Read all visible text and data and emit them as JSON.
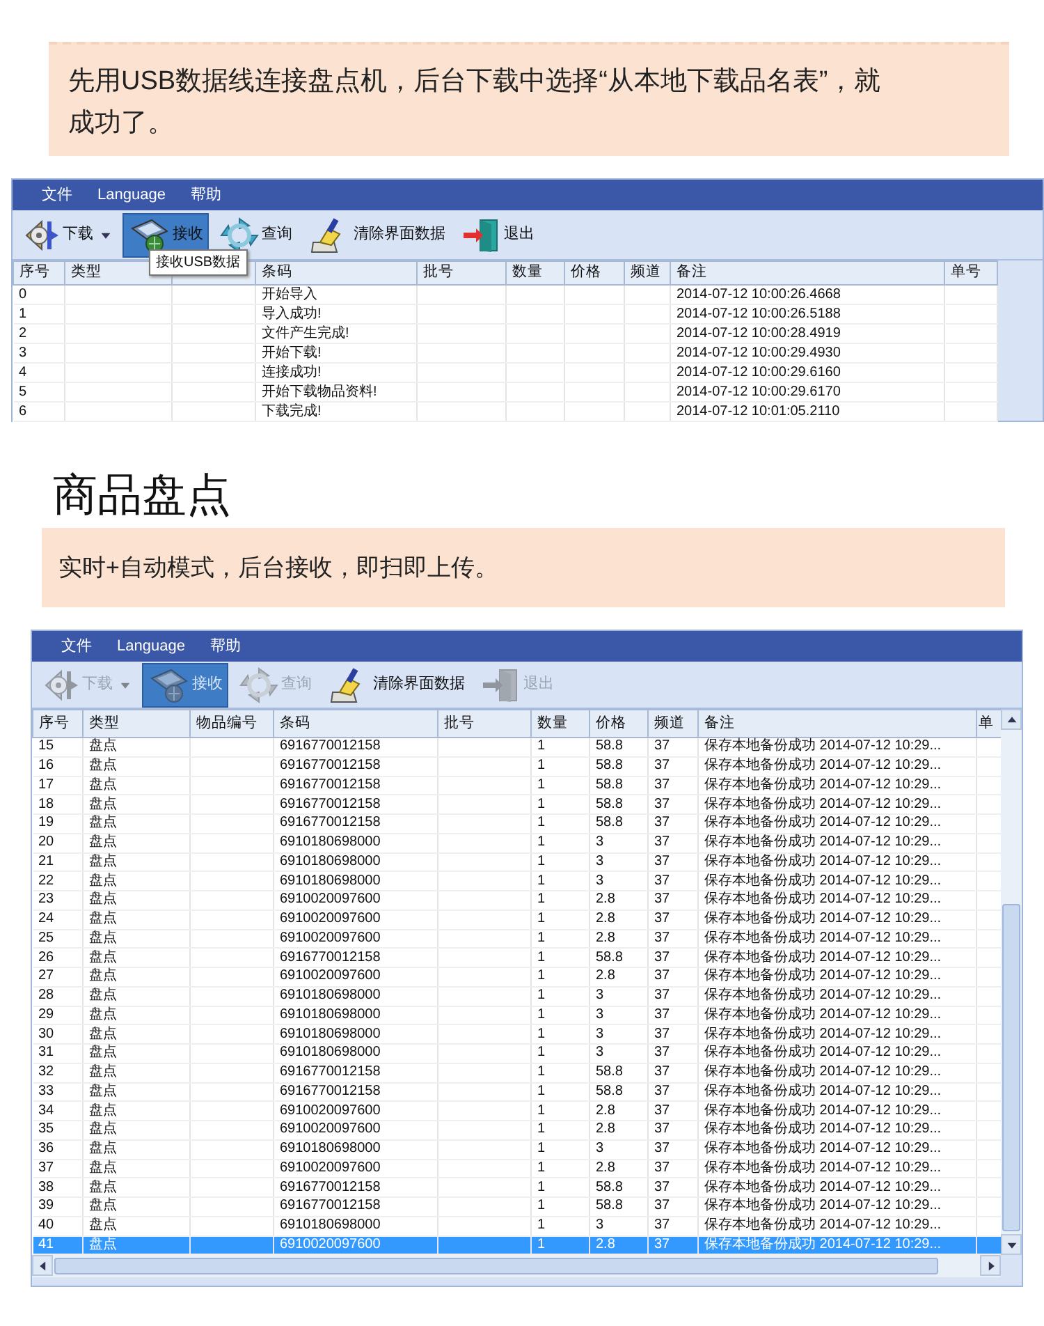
{
  "note_top": {
    "text": "先用USB数据线连接盘点机，后台下载中选择“从本地下载品名表”，就成功了。"
  },
  "windows": [
    {
      "menu": [
        "文件",
        "Language",
        "帮助"
      ],
      "toolbar": [
        {
          "kind": "download",
          "label": "下载",
          "dropdown": true,
          "disabled": false,
          "selected": false
        },
        {
          "kind": "receive",
          "label": "接收",
          "dropdown": false,
          "disabled": false,
          "selected": true
        },
        {
          "kind": "query",
          "label": "查询",
          "dropdown": false,
          "disabled": false,
          "selected": false
        },
        {
          "kind": "clear",
          "label": "清除界面数据",
          "dropdown": false,
          "disabled": false,
          "selected": false
        },
        {
          "kind": "exit",
          "label": "退出",
          "dropdown": false,
          "disabled": false,
          "selected": false
        }
      ],
      "tooltip": "接收USB数据",
      "scrollbars": false,
      "columns": [
        "序号",
        "类型",
        null,
        "条码",
        "批号",
        "数量",
        "价格",
        "频道",
        "备注",
        "单号"
      ],
      "rows": [
        {
          "cells": [
            "0",
            null,
            null,
            "开始导入",
            null,
            null,
            null,
            null,
            "2014-07-12 10:00:26.4668",
            null
          ]
        },
        {
          "cells": [
            "1",
            null,
            null,
            "导入成功!",
            null,
            null,
            null,
            null,
            "2014-07-12 10:00:26.5188",
            null
          ]
        },
        {
          "cells": [
            "2",
            null,
            null,
            "文件产生完成!",
            null,
            null,
            null,
            null,
            "2014-07-12 10:00:28.4919",
            null
          ]
        },
        {
          "cells": [
            "3",
            null,
            null,
            "开始下载!",
            null,
            null,
            null,
            null,
            "2014-07-12 10:00:29.4930",
            null
          ]
        },
        {
          "cells": [
            "4",
            null,
            null,
            "连接成功!",
            null,
            null,
            null,
            null,
            "2014-07-12 10:00:29.6160",
            null
          ]
        },
        {
          "cells": [
            "5",
            null,
            null,
            "开始下载物品资料!",
            null,
            null,
            null,
            null,
            "2014-07-12 10:00:29.6170",
            null
          ]
        },
        {
          "cells": [
            "6",
            null,
            null,
            "下载完成!",
            null,
            null,
            null,
            null,
            "2014-07-12 10:01:05.2110",
            null
          ]
        }
      ]
    },
    {
      "heading": "商品盘点",
      "note": "实时+自动模式，后台接收，即扫即上传。",
      "menu": [
        "文件",
        "Language",
        "帮助"
      ],
      "toolbar": [
        {
          "kind": "download",
          "label": "下载",
          "dropdown": true,
          "disabled": true,
          "selected": false
        },
        {
          "kind": "receive",
          "label": "接收",
          "dropdown": false,
          "disabled": true,
          "selected": true
        },
        {
          "kind": "query",
          "label": "查询",
          "dropdown": false,
          "disabled": true,
          "selected": false
        },
        {
          "kind": "clear",
          "label": "清除界面数据",
          "dropdown": false,
          "disabled": false,
          "selected": false
        },
        {
          "kind": "exit",
          "label": "退出",
          "dropdown": false,
          "disabled": true,
          "selected": false
        }
      ],
      "scrollbars": true,
      "columns": [
        "序号",
        "类型",
        "物品编号",
        "条码",
        "批号",
        "数量",
        "价格",
        "频道",
        "备注",
        "单"
      ],
      "rows": [
        {
          "selected": false,
          "cells": [
            "15",
            "盘点",
            null,
            "6916770012158",
            null,
            "1",
            "58.8",
            "37",
            "保存本地备份成功 2014-07-12 10:29...",
            null
          ]
        },
        {
          "selected": false,
          "cells": [
            "16",
            "盘点",
            null,
            "6916770012158",
            null,
            "1",
            "58.8",
            "37",
            "保存本地备份成功 2014-07-12 10:29...",
            null
          ]
        },
        {
          "selected": false,
          "cells": [
            "17",
            "盘点",
            null,
            "6916770012158",
            null,
            "1",
            "58.8",
            "37",
            "保存本地备份成功 2014-07-12 10:29...",
            null
          ]
        },
        {
          "selected": false,
          "cells": [
            "18",
            "盘点",
            null,
            "6916770012158",
            null,
            "1",
            "58.8",
            "37",
            "保存本地备份成功 2014-07-12 10:29...",
            null
          ]
        },
        {
          "selected": false,
          "cells": [
            "19",
            "盘点",
            null,
            "6916770012158",
            null,
            "1",
            "58.8",
            "37",
            "保存本地备份成功 2014-07-12 10:29...",
            null
          ]
        },
        {
          "selected": false,
          "cells": [
            "20",
            "盘点",
            null,
            "6910180698000",
            null,
            "1",
            "3",
            "37",
            "保存本地备份成功 2014-07-12 10:29...",
            null
          ]
        },
        {
          "selected": false,
          "cells": [
            "21",
            "盘点",
            null,
            "6910180698000",
            null,
            "1",
            "3",
            "37",
            "保存本地备份成功 2014-07-12 10:29...",
            null
          ]
        },
        {
          "selected": false,
          "cells": [
            "22",
            "盘点",
            null,
            "6910180698000",
            null,
            "1",
            "3",
            "37",
            "保存本地备份成功 2014-07-12 10:29...",
            null
          ]
        },
        {
          "selected": false,
          "cells": [
            "23",
            "盘点",
            null,
            "6910020097600",
            null,
            "1",
            "2.8",
            "37",
            "保存本地备份成功 2014-07-12 10:29...",
            null
          ]
        },
        {
          "selected": false,
          "cells": [
            "24",
            "盘点",
            null,
            "6910020097600",
            null,
            "1",
            "2.8",
            "37",
            "保存本地备份成功 2014-07-12 10:29...",
            null
          ]
        },
        {
          "selected": false,
          "cells": [
            "25",
            "盘点",
            null,
            "6910020097600",
            null,
            "1",
            "2.8",
            "37",
            "保存本地备份成功 2014-07-12 10:29...",
            null
          ]
        },
        {
          "selected": false,
          "cells": [
            "26",
            "盘点",
            null,
            "6916770012158",
            null,
            "1",
            "58.8",
            "37",
            "保存本地备份成功 2014-07-12 10:29...",
            null
          ]
        },
        {
          "selected": false,
          "cells": [
            "27",
            "盘点",
            null,
            "6910020097600",
            null,
            "1",
            "2.8",
            "37",
            "保存本地备份成功 2014-07-12 10:29...",
            null
          ]
        },
        {
          "selected": false,
          "cells": [
            "28",
            "盘点",
            null,
            "6910180698000",
            null,
            "1",
            "3",
            "37",
            "保存本地备份成功 2014-07-12 10:29...",
            null
          ]
        },
        {
          "selected": false,
          "cells": [
            "29",
            "盘点",
            null,
            "6910180698000",
            null,
            "1",
            "3",
            "37",
            "保存本地备份成功 2014-07-12 10:29...",
            null
          ]
        },
        {
          "selected": false,
          "cells": [
            "30",
            "盘点",
            null,
            "6910180698000",
            null,
            "1",
            "3",
            "37",
            "保存本地备份成功 2014-07-12 10:29...",
            null
          ]
        },
        {
          "selected": false,
          "cells": [
            "31",
            "盘点",
            null,
            "6910180698000",
            null,
            "1",
            "3",
            "37",
            "保存本地备份成功 2014-07-12 10:29...",
            null
          ]
        },
        {
          "selected": false,
          "cells": [
            "32",
            "盘点",
            null,
            "6916770012158",
            null,
            "1",
            "58.8",
            "37",
            "保存本地备份成功 2014-07-12 10:29...",
            null
          ]
        },
        {
          "selected": false,
          "cells": [
            "33",
            "盘点",
            null,
            "6916770012158",
            null,
            "1",
            "58.8",
            "37",
            "保存本地备份成功 2014-07-12 10:29...",
            null
          ]
        },
        {
          "selected": false,
          "cells": [
            "34",
            "盘点",
            null,
            "6910020097600",
            null,
            "1",
            "2.8",
            "37",
            "保存本地备份成功 2014-07-12 10:29...",
            null
          ]
        },
        {
          "selected": false,
          "cells": [
            "35",
            "盘点",
            null,
            "6910020097600",
            null,
            "1",
            "2.8",
            "37",
            "保存本地备份成功 2014-07-12 10:29...",
            null
          ]
        },
        {
          "selected": false,
          "cells": [
            "36",
            "盘点",
            null,
            "6910180698000",
            null,
            "1",
            "3",
            "37",
            "保存本地备份成功 2014-07-12 10:29...",
            null
          ]
        },
        {
          "selected": false,
          "cells": [
            "37",
            "盘点",
            null,
            "6910020097600",
            null,
            "1",
            "2.8",
            "37",
            "保存本地备份成功 2014-07-12 10:29...",
            null
          ]
        },
        {
          "selected": false,
          "cells": [
            "38",
            "盘点",
            null,
            "6916770012158",
            null,
            "1",
            "58.8",
            "37",
            "保存本地备份成功 2014-07-12 10:29...",
            null
          ]
        },
        {
          "selected": false,
          "cells": [
            "39",
            "盘点",
            null,
            "6916770012158",
            null,
            "1",
            "58.8",
            "37",
            "保存本地备份成功 2014-07-12 10:29...",
            null
          ]
        },
        {
          "selected": false,
          "cells": [
            "40",
            "盘点",
            null,
            "6910180698000",
            null,
            "1",
            "3",
            "37",
            "保存本地备份成功 2014-07-12 10:29...",
            null
          ]
        },
        {
          "selected": true,
          "cells": [
            "41",
            "盘点",
            null,
            "6910020097600",
            null,
            "1",
            "2.8",
            "37",
            "保存本地备份成功 2014-07-12 10:29...",
            null
          ]
        }
      ]
    }
  ]
}
